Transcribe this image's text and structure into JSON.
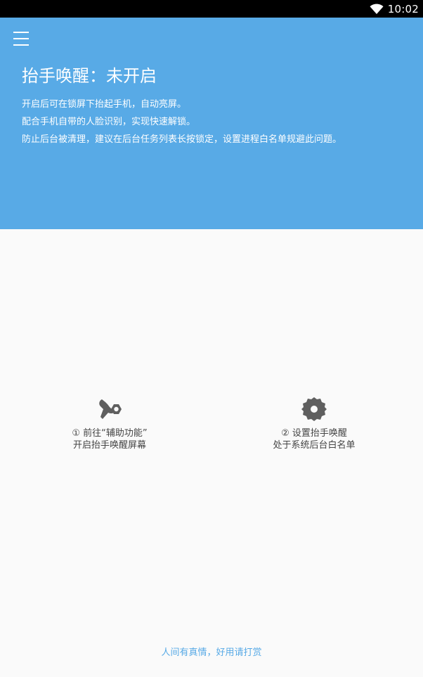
{
  "status_bar": {
    "time": "10:02",
    "wifi_icon": "wifi-icon"
  },
  "header": {
    "menu_icon": "hamburger-menu-icon",
    "title": "抬手唤醒：未开启",
    "description": [
      "开启后可在锁屏下抬起手机，自动亮屏。",
      "配合手机自带的人脸识别，实现快速解锁。",
      "防止后台被清理，建议在后台任务列表长按锁定，设置进程白名单规避此问题。"
    ],
    "background_color": "#58aae6"
  },
  "options": [
    {
      "icon": "accessibility-tools-icon",
      "line1": "① 前往“辅助功能”",
      "line2": "开启抬手唤醒屏幕"
    },
    {
      "icon": "gear-icon",
      "line1": "② 设置抬手唤醒",
      "line2": "处于系统后台白名单"
    }
  ],
  "footer": {
    "link_text": "人间有真情，好用请打赏",
    "color": "#58aae6"
  }
}
